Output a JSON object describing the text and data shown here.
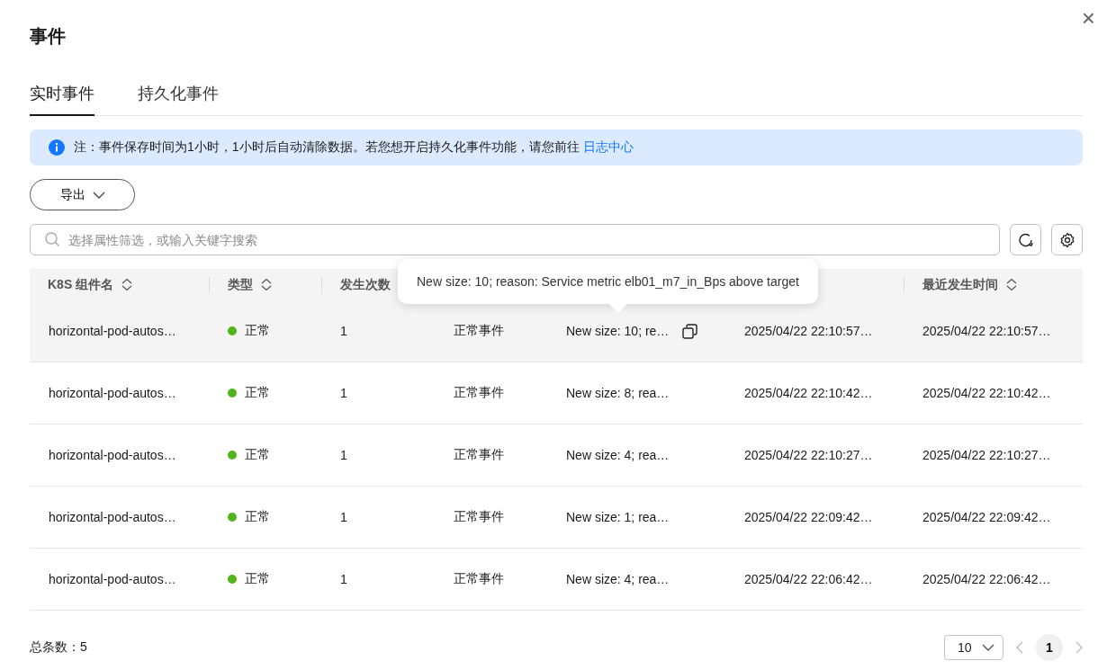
{
  "dialog": {
    "title": "事件",
    "close": "×"
  },
  "tabs": [
    {
      "label": "实时事件",
      "selected": true
    },
    {
      "label": "持久化事件",
      "selected": false
    }
  ],
  "notice": {
    "text": "注：事件保存时间为1小时，1小时后自动清除数据。若您想开启持久化事件功能，请您前往",
    "link": "日志中心"
  },
  "export_button": {
    "label": "导出"
  },
  "search": {
    "placeholder": "选择属性筛选，或输入关键字搜索"
  },
  "table": {
    "columns": [
      {
        "label": "K8S 组件名",
        "sortable": true
      },
      {
        "label": "类型",
        "sortable": true
      },
      {
        "label": "发生次数"
      },
      {},
      {},
      {},
      {
        "label": "最近发生时间",
        "sortable": true
      }
    ],
    "rows": [
      {
        "hovered": true,
        "color": "#52b41a",
        "cells": [
          "horizontal-pod-autos…",
          "正常",
          "1",
          "正常事件",
          "New size: 10; re…",
          "2025/04/22 22:10:57…",
          "2025/04/22 22:10:57…"
        ]
      },
      {
        "hovered": false,
        "color": "#52b41a",
        "cells": [
          "horizontal-pod-autos…",
          "正常",
          "1",
          "正常事件",
          "New size: 8; rea…",
          "2025/04/22 22:10:42…",
          "2025/04/22 22:10:42…"
        ]
      },
      {
        "hovered": false,
        "color": "#52b41a",
        "cells": [
          "horizontal-pod-autos…",
          "正常",
          "1",
          "正常事件",
          "New size: 4; rea…",
          "2025/04/22 22:10:27…",
          "2025/04/22 22:10:27…"
        ]
      },
      {
        "hovered": false,
        "color": "#52b41a",
        "cells": [
          "horizontal-pod-autos…",
          "正常",
          "1",
          "正常事件",
          "New size: 1; rea…",
          "2025/04/22 22:09:42…",
          "2025/04/22 22:09:42…"
        ]
      },
      {
        "hovered": false,
        "color": "#52b41a",
        "cells": [
          "horizontal-pod-autos…",
          "正常",
          "1",
          "正常事件",
          "New size: 4; rea…",
          "2025/04/22 22:06:42…",
          "2025/04/22 22:06:42…"
        ]
      }
    ]
  },
  "tooltip": {
    "text": "New size: 10; reason: Service metric elb01_m7_in_Bps above target"
  },
  "footer": {
    "total": "总条数：5",
    "page_size": "10",
    "pages": [
      {
        "label": "1",
        "selected": true
      }
    ]
  }
}
